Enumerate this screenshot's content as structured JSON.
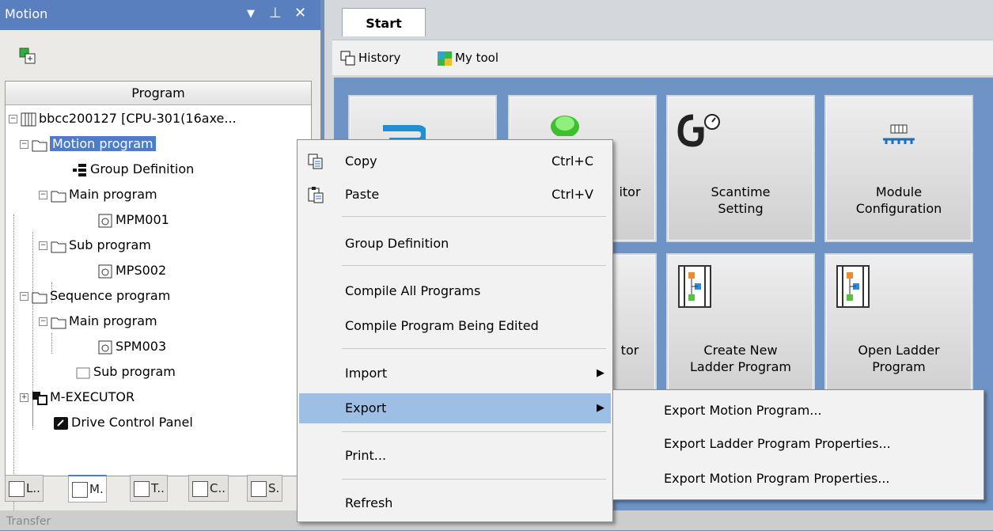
{
  "panel": {
    "title": "Motion",
    "controls": {
      "dropdown": "▼",
      "pin": "⊥",
      "close": "✕"
    },
    "tree_header": "Program",
    "tree": [
      {
        "label": "bbcc200127 [CPU-301(16axe...",
        "expander": "−"
      },
      {
        "label": "Motion program",
        "expander": "−",
        "selected": true
      },
      {
        "label": "Group Definition"
      },
      {
        "label": "Main program",
        "expander": "−"
      },
      {
        "label": "MPM001"
      },
      {
        "label": "Sub program",
        "expander": "−"
      },
      {
        "label": "MPS002"
      },
      {
        "label": "Sequence program",
        "expander": "−"
      },
      {
        "label": "Main program",
        "expander": "−"
      },
      {
        "label": "SPM003"
      },
      {
        "label": "Sub program"
      },
      {
        "label": "M-EXECUTOR",
        "expander": "+"
      },
      {
        "label": "Drive Control Panel"
      }
    ],
    "tabs": [
      "L..",
      "M.",
      "T..",
      "C..",
      "S."
    ]
  },
  "status_text": "Transfer",
  "start": {
    "tab_label": "Start",
    "toolbar": {
      "history": "History",
      "mytool": "My tool"
    },
    "tiles": [
      {
        "caption": ""
      },
      {
        "caption": "itor"
      },
      {
        "caption": "Scantime\nSetting"
      },
      {
        "caption": "Module\nConfiguration"
      },
      {
        "caption": ""
      },
      {
        "caption": "tor"
      },
      {
        "caption": "Create New\nLadder Program"
      },
      {
        "caption": "Open Ladder\nProgram"
      }
    ]
  },
  "menu": {
    "copy": {
      "label": "Copy",
      "shortcut": "Ctrl+C"
    },
    "paste": {
      "label": "Paste",
      "shortcut": "Ctrl+V"
    },
    "group_def": "Group Definition",
    "compile_all": "Compile All Programs",
    "compile_edit": "Compile Program Being Edited",
    "import": "Import",
    "export": "Export",
    "print": "Print...",
    "refresh": "Refresh",
    "arrow": "▶"
  },
  "submenu": {
    "items": [
      "Export Motion Program...",
      "Export Ladder Program Properties...",
      "Export Motion Program Properties..."
    ]
  },
  "colors": {
    "accent": "#4f7cc8",
    "highlight": "#9ebfe5",
    "tile_bg": "#6e93c5"
  }
}
